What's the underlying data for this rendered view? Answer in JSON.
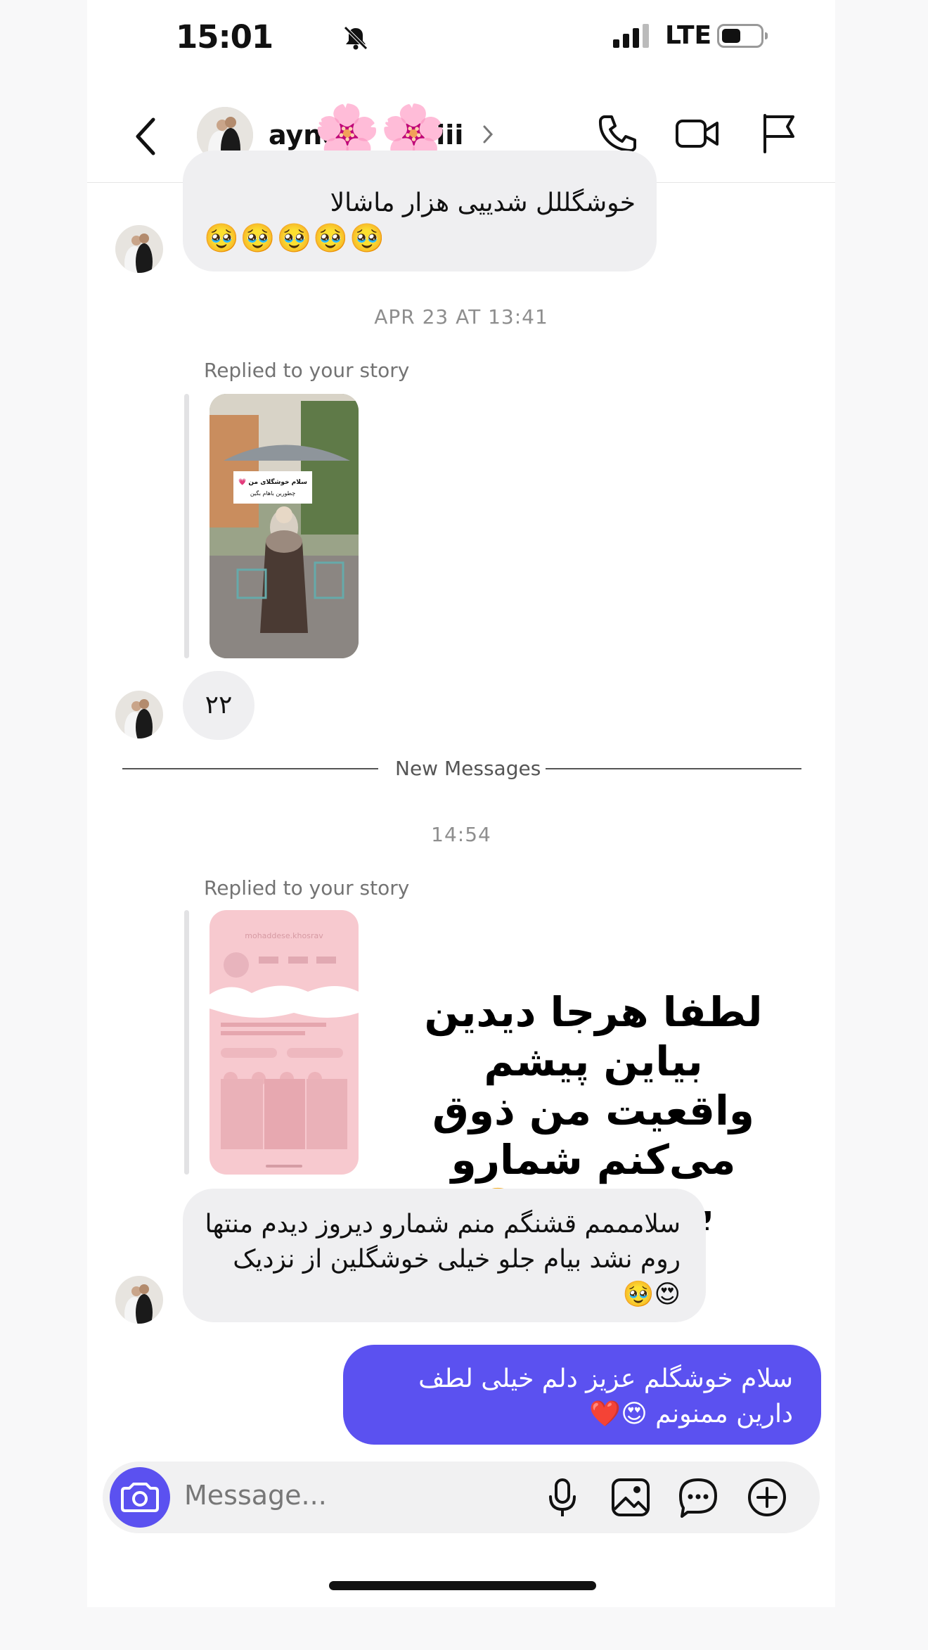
{
  "status_bar": {
    "time": "15:01",
    "network": "LTE"
  },
  "header": {
    "username": "aynd",
    "username_tail": "viii",
    "flower_emoji": "🌸🌸"
  },
  "messages": {
    "m1_line1": "خوشگللل شدییی هزار ماشالا",
    "m1_emojis": "🥹🥹🥹🥹🥹",
    "timestamp1": "APR 23 AT 13:41",
    "replied_label_1": "Replied to your story",
    "story1_sticker": "سلام خوشگلای من 💗 چطورین باهام بگین دوست داری",
    "m2": "۲۲",
    "new_messages": "New Messages",
    "timestamp2": "14:54",
    "replied_label_2": "Replied to your story",
    "story2_username": "mohaddese.khosrav",
    "story2_caption_line1": "لطفا هرجا دیدین بیاین پیشم",
    "story2_caption_line2": "واقعیت من ذوق می‌کنم شمارو",
    "story2_caption_line3": "ببینم😍❤️🥹",
    "m3": "سلامممم قشنگم منم شمارو دیروز دیدم منتها روم نشد بیام جلو خیلی خوشگلین از نزدیک 😍🥹",
    "m4": "سلام خوشگلم عزیز دلم خیلی لطف دارین ممنونم 😍❤️"
  },
  "composer": {
    "placeholder": "Message..."
  },
  "colors": {
    "accent": "#5b51f0",
    "bubble_in": "#efeff1"
  }
}
